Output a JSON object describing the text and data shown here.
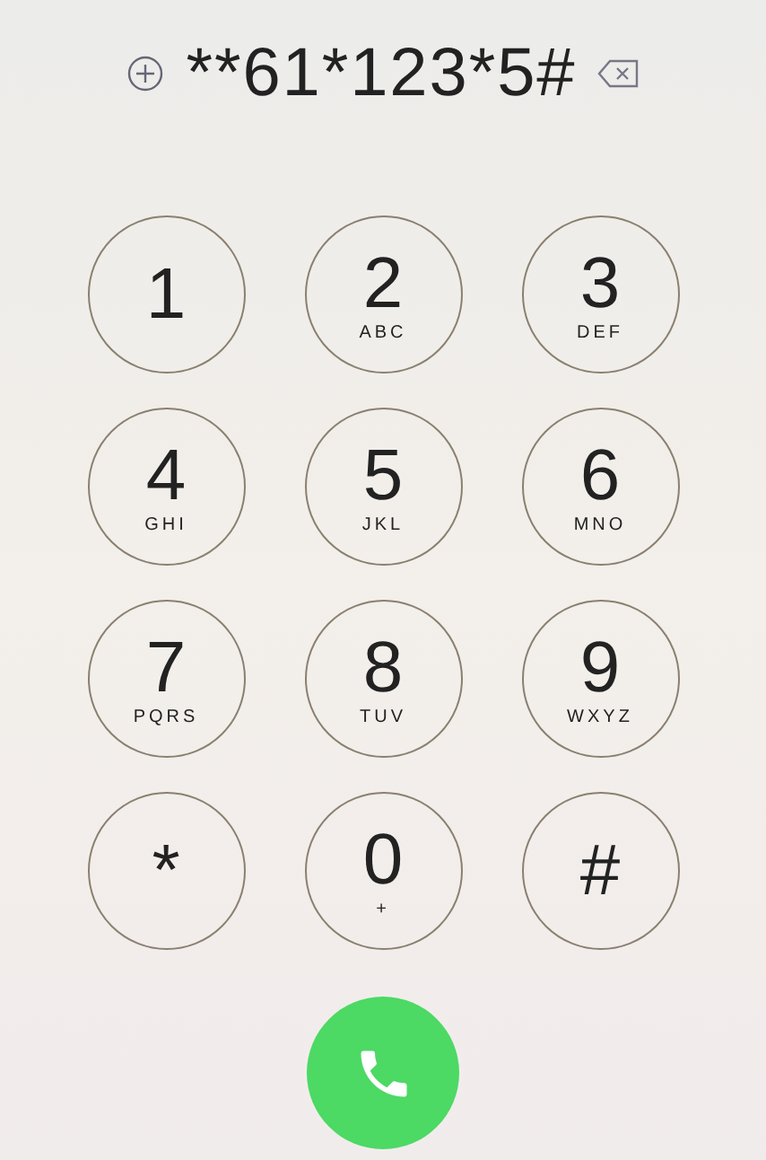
{
  "dialed_number": "**61*123*5#",
  "keys": [
    {
      "digit": "1"
    },
    {
      "digit": "2",
      "letters": "ABC"
    },
    {
      "digit": "3",
      "letters": "DEF"
    },
    {
      "digit": "4",
      "letters": "GHI"
    },
    {
      "digit": "5",
      "letters": "JKL"
    },
    {
      "digit": "6",
      "letters": "MNO"
    },
    {
      "digit": "7",
      "letters": "PQRS"
    },
    {
      "digit": "8",
      "letters": "TUV"
    },
    {
      "digit": "9",
      "letters": "WXYZ"
    },
    {
      "digit": "*"
    },
    {
      "digit": "0",
      "letters": "+"
    },
    {
      "digit": "#"
    }
  ]
}
